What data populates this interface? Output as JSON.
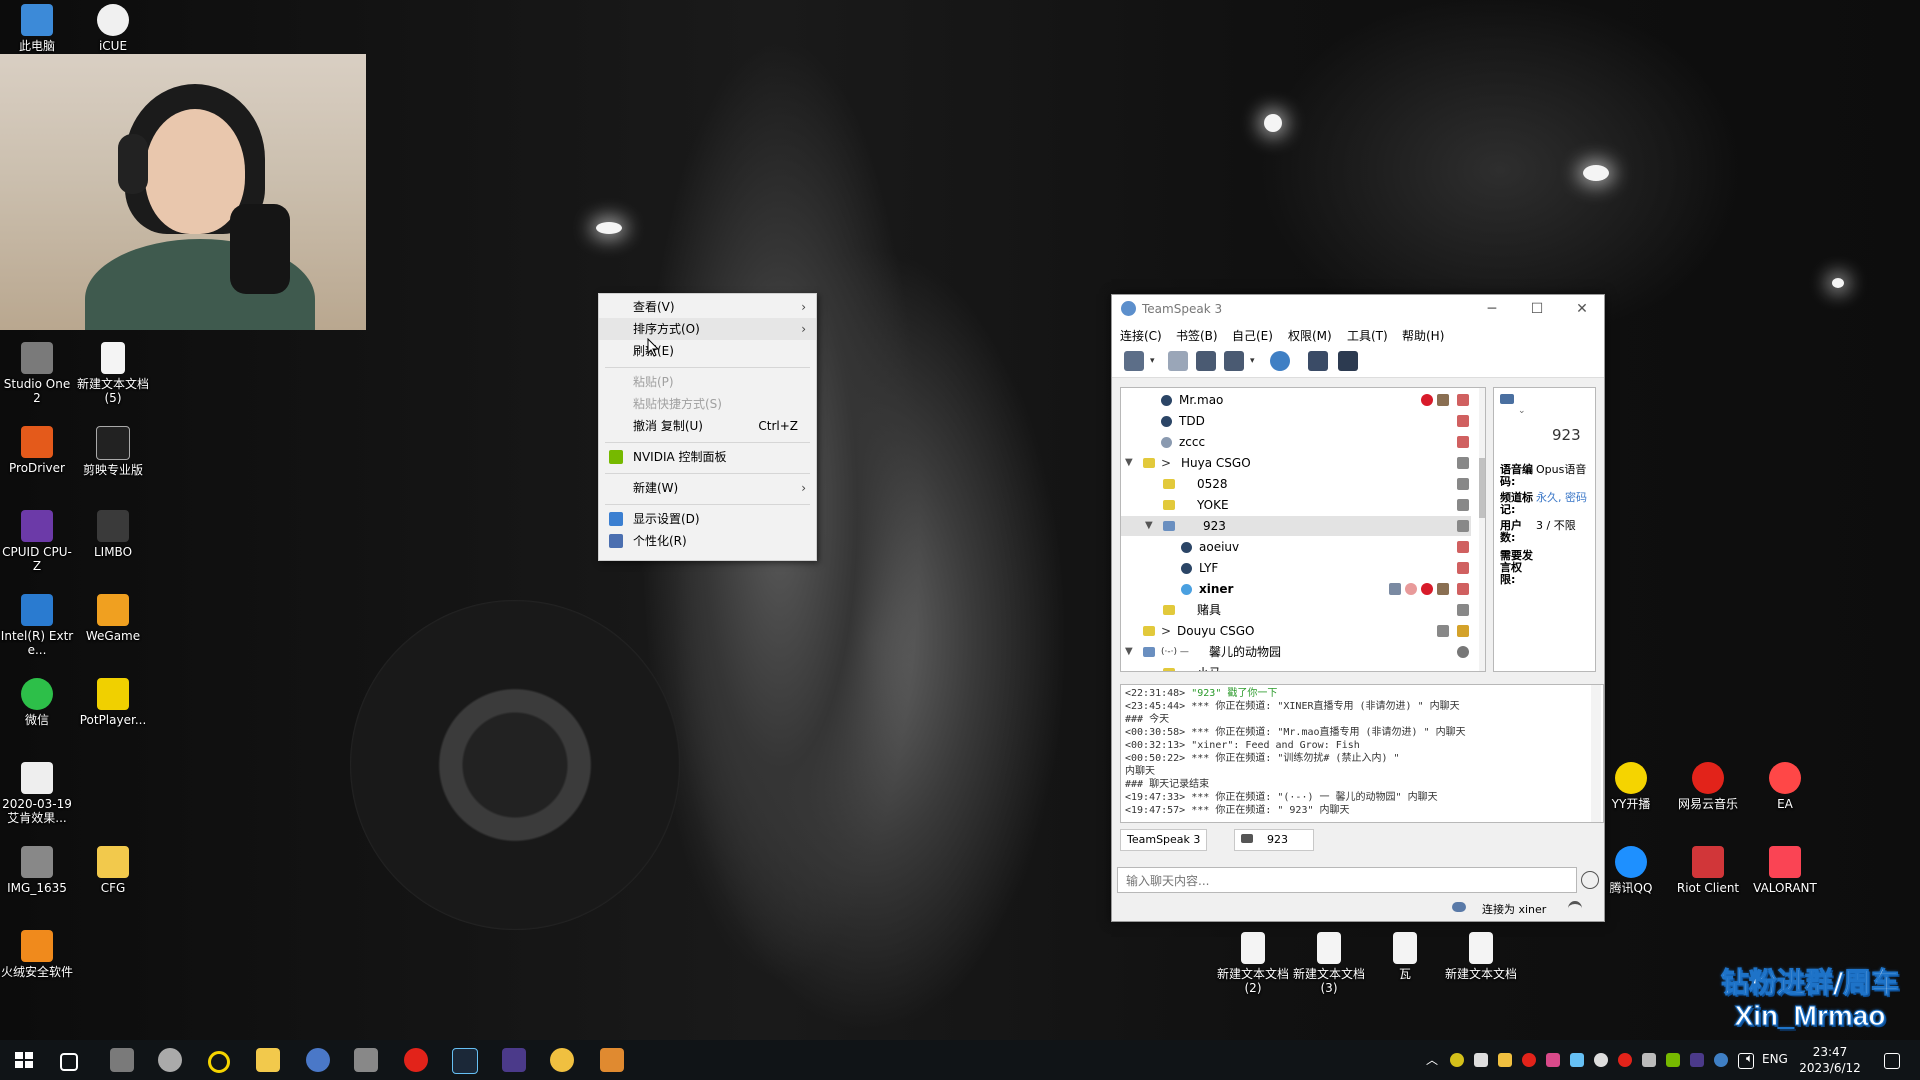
{
  "desktop": {
    "top_icons": [
      {
        "label": "此电脑",
        "icon": "computer-icon",
        "color": "#3c8ad8"
      },
      {
        "label": "iCUE",
        "icon": "icue-icon",
        "color": "#f0f0f0"
      }
    ],
    "icons": [
      {
        "label": "Studio One 2",
        "icon": "studio-one-icon",
        "color": "#7a7a7a"
      },
      {
        "label": "新建文本文档 (5)",
        "icon": "text-doc-icon",
        "color": "#f4f4f4"
      },
      {
        "label": "ProDriver",
        "icon": "prodriver-icon",
        "color": "#e45a1b"
      },
      {
        "label": "剪映专业版",
        "icon": "capcut-icon",
        "color": "#222222"
      },
      {
        "label": "CPUID CPU-Z",
        "icon": "cpuz-icon",
        "color": "#6c3aa8"
      },
      {
        "label": "LIMBO",
        "icon": "limbo-icon",
        "color": "#3a3a3a"
      },
      {
        "label": "Intel(R) Extre...",
        "icon": "intel-icon",
        "color": "#2a7bd0"
      },
      {
        "label": "WeGame",
        "icon": "wegame-icon",
        "color": "#f0a020"
      },
      {
        "label": "微信",
        "icon": "wechat-icon",
        "color": "#2dbf49"
      },
      {
        "label": "PotPlayer...",
        "icon": "potplayer-icon",
        "color": "#f0d000"
      },
      {
        "label": "2020-03-19 艾肯效果...",
        "icon": "shortcut-icon",
        "color": "#eeeeee"
      },
      {
        "label": "IMG_1635",
        "icon": "image-icon",
        "color": "#888888"
      },
      {
        "label": "CFG",
        "icon": "folder-icon",
        "color": "#f2c94c"
      },
      {
        "label": "火绒安全软件",
        "icon": "huorong-icon",
        "color": "#f08a1c"
      }
    ],
    "right_icons": [
      {
        "label": "YY开播",
        "icon": "yy-icon",
        "color": "#f5d400"
      },
      {
        "label": "网易云音乐",
        "icon": "netease-music-icon",
        "color": "#e2231a"
      },
      {
        "label": "EA",
        "icon": "ea-icon",
        "color": "#ff4747"
      },
      {
        "label": "腾讯QQ",
        "icon": "qq-icon",
        "color": "#1e90ff"
      },
      {
        "label": "Riot Client",
        "icon": "riot-icon",
        "color": "#d13639"
      },
      {
        "label": "VALORANT",
        "icon": "valorant-icon",
        "color": "#fa4454"
      }
    ],
    "bottom_icons": [
      {
        "label": "新建文本文档 (2)",
        "icon": "text-doc-icon"
      },
      {
        "label": "新建文本文档 (3)",
        "icon": "text-doc-icon"
      },
      {
        "label": "瓦",
        "icon": "text-doc-icon"
      },
      {
        "label": "新建文本文档",
        "icon": "text-doc-icon"
      }
    ]
  },
  "context_menu": {
    "items": [
      {
        "label": "查看(V)",
        "submenu": true
      },
      {
        "label": "排序方式(O)",
        "submenu": true
      },
      {
        "label": "刷新(E)"
      },
      {
        "label": "粘贴(P)",
        "disabled": true
      },
      {
        "label": "粘贴快捷方式(S)",
        "disabled": true
      },
      {
        "label": "撤消 复制(U)",
        "shortcut": "Ctrl+Z"
      },
      {
        "label": "NVIDIA 控制面板",
        "icon": "nvidia-icon"
      },
      {
        "label": "新建(W)",
        "submenu": true
      },
      {
        "label": "显示设置(D)",
        "icon": "display-icon"
      },
      {
        "label": "个性化(R)",
        "icon": "personalize-icon"
      }
    ]
  },
  "teamspeak": {
    "title": "TeamSpeak 3",
    "menu": [
      "连接(C)",
      "书签(B)",
      "自己(E)",
      "权限(M)",
      "工具(T)",
      "帮助(H)"
    ],
    "tree": [
      {
        "name": "Mr.mao",
        "kind": "user"
      },
      {
        "name": "TDD",
        "kind": "user"
      },
      {
        "name": "zccc",
        "kind": "user-away"
      },
      {
        "name": "Huya CSGO",
        "kind": "channel",
        "expanded": true
      },
      {
        "name": "0528",
        "kind": "subchannel"
      },
      {
        "name": "YOKE",
        "kind": "subchannel"
      },
      {
        "name": "923",
        "kind": "subchannel",
        "expanded": true,
        "selected": true
      },
      {
        "name": "aoeiuv",
        "kind": "user"
      },
      {
        "name": "LYF",
        "kind": "user"
      },
      {
        "name": "xiner",
        "kind": "user-self"
      },
      {
        "name": "赌具",
        "kind": "subchannel"
      },
      {
        "name": "Douyu CSGO",
        "kind": "channel"
      },
      {
        "name": "馨儿的动物园",
        "kind": "channel",
        "expanded": true
      },
      {
        "name": "小马",
        "kind": "subchannel"
      }
    ],
    "info": {
      "channel": "923",
      "rows": [
        {
          "k": "语音编码:",
          "v": "Opus语音"
        },
        {
          "k": "频道标记:",
          "v": "永久, 密码"
        },
        {
          "k": "用户数:",
          "v": "3 / 不限"
        },
        {
          "k": "需要发言权限:",
          "v": ""
        }
      ]
    },
    "chat": [
      {
        "time": "<22:31:48>",
        "text": "\"923\" 戳了你一下"
      },
      {
        "time": "<23:45:44>",
        "text": "*** 你正在频道: \"XINER直播专用 (非请勿进) \" 内聊天"
      },
      {
        "time": "###",
        "text": "今天"
      },
      {
        "time": "<00:30:58>",
        "text": "*** 你正在频道: \"Mr.mao直播专用 (非请勿进) \" 内聊天"
      },
      {
        "time": "<00:32:13>",
        "text": "\"xiner\": Feed and Grow: Fish"
      },
      {
        "time": "<00:50:22>",
        "text": "*** 你正在频道: \"训练勿扰#          (禁止入内) \""
      },
      {
        "time": "",
        "text": "内聊天"
      },
      {
        "time": "###",
        "text": "聊天记录结束"
      },
      {
        "time": "<19:47:33>",
        "text": "*** 你正在频道: \"(·-·) 一    馨儿的动物园\" 内聊天"
      },
      {
        "time": "<19:47:57>",
        "text": "*** 你正在频道: \"        923\" 内聊天"
      }
    ],
    "tabs": [
      "TeamSpeak 3",
      "923"
    ],
    "input_placeholder": "输入聊天内容...",
    "status": "连接为 xiner"
  },
  "taskbar": {
    "clock_time": "23:47",
    "clock_date": "2023/6/12",
    "lang": "ENG"
  },
  "watermark": {
    "line1": "钻粉进群/周车",
    "line2": "Xin_Mrmao"
  }
}
